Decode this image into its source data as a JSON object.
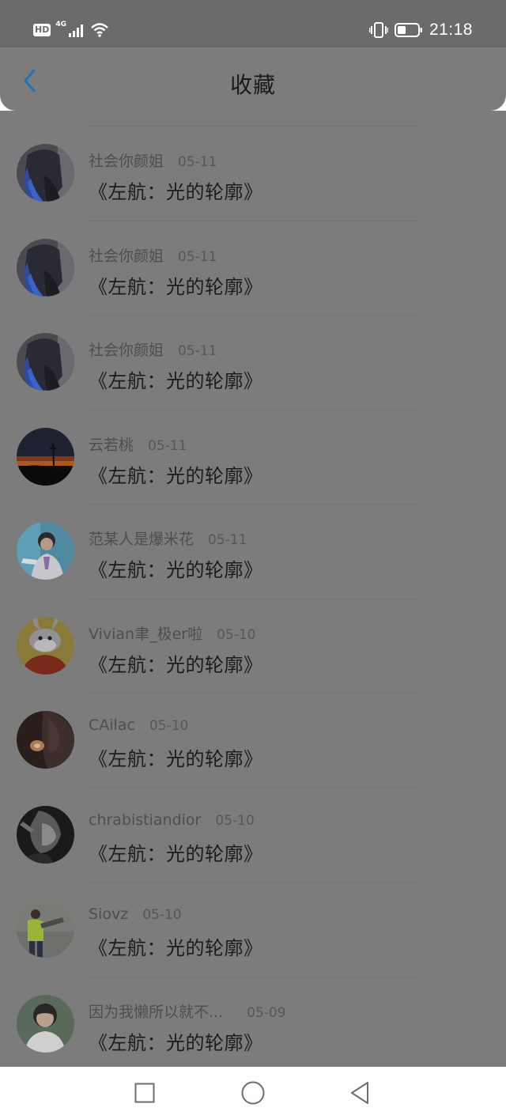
{
  "status_bar": {
    "hd": "HD",
    "network": "4G",
    "time": "21:18",
    "icons": [
      "hd-icon",
      "signal-icon",
      "wifi-icon",
      "vibrate-icon",
      "battery-icon"
    ]
  },
  "header": {
    "title": "收藏",
    "back_icon": "chevron-left-icon",
    "accent_color": "#1f73b7"
  },
  "items": [
    {
      "user": "社会你颜姐",
      "date": "05-11",
      "title": "《左航：光的轮廓》",
      "avatar": "blue-hair-portrait"
    },
    {
      "user": "社会你颜姐",
      "date": "05-11",
      "title": "《左航：光的轮廓》",
      "avatar": "blue-hair-portrait"
    },
    {
      "user": "社会你颜姐",
      "date": "05-11",
      "title": "《左航：光的轮廓》",
      "avatar": "blue-hair-portrait"
    },
    {
      "user": "云若桃",
      "date": "05-11",
      "title": "《左航：光的轮廓》",
      "avatar": "sunset-sky"
    },
    {
      "user": "范某人是爆米花",
      "date": "05-11",
      "title": "《左航：光的轮廓》",
      "avatar": "boy-blue-background"
    },
    {
      "user": "Vivian聿_极er啦",
      "date": "05-10",
      "title": "《左航：光的轮廓》",
      "avatar": "cartoon-rabbit"
    },
    {
      "user": "CAilac",
      "date": "05-10",
      "title": "《左航：光的轮廓》",
      "avatar": "dark-portrait"
    },
    {
      "user": "chrabistiandior",
      "date": "05-10",
      "title": "《左航：光的轮廓》",
      "avatar": "black-white-portrait"
    },
    {
      "user": "Siovz",
      "date": "05-10",
      "title": "《左航：光的轮廓》",
      "avatar": "person-yellow-jacket"
    },
    {
      "user": "因为我懒所以就不...",
      "date": "05-09",
      "title": "《左航：光的轮廓》",
      "avatar": "boy-white-shirt"
    }
  ],
  "nav_bar": {
    "icons": [
      "recent-apps-icon",
      "home-icon",
      "back-icon"
    ]
  }
}
